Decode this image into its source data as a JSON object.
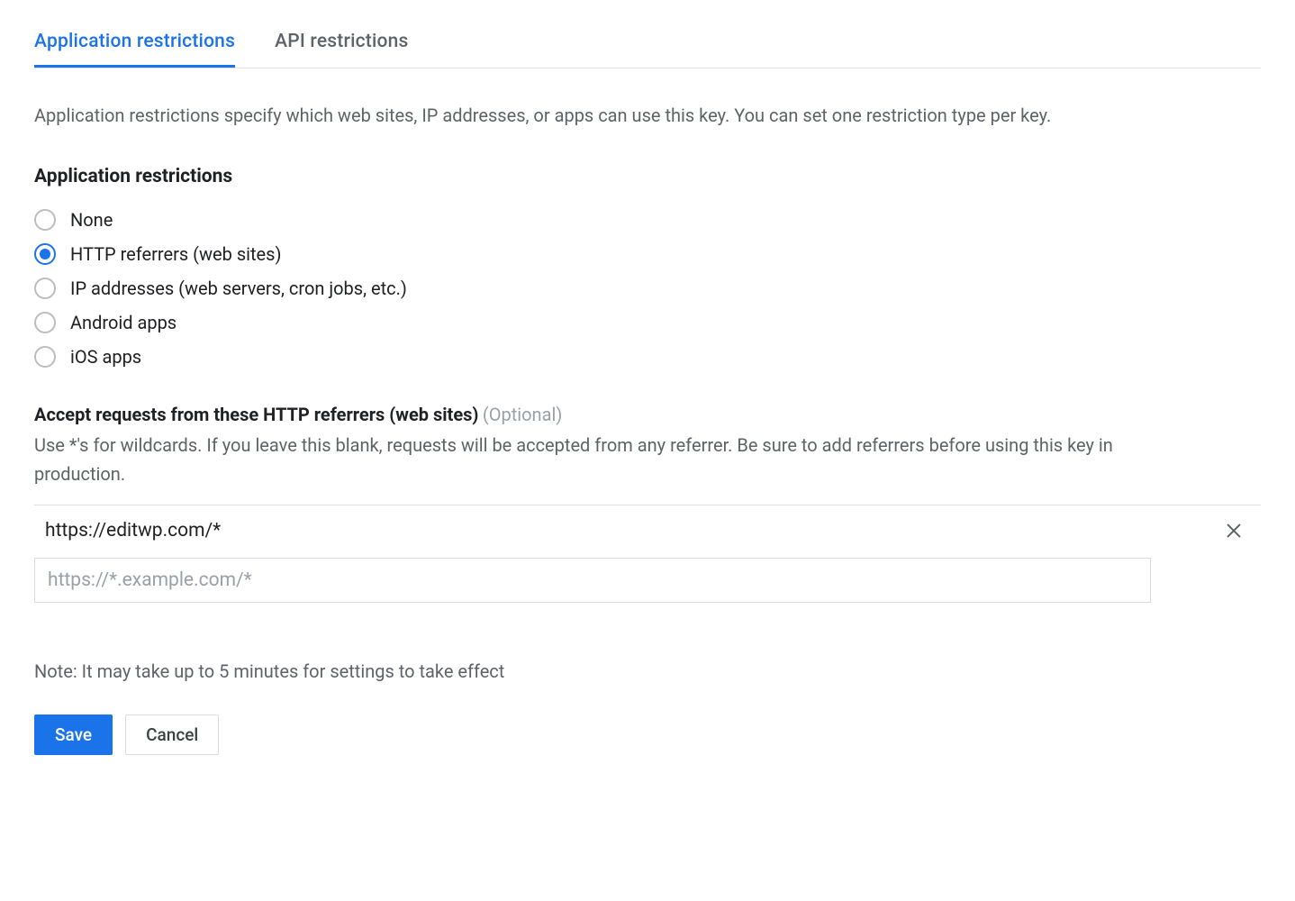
{
  "tabs": {
    "application_restrictions": "Application restrictions",
    "api_restrictions": "API restrictions",
    "active": "application_restrictions"
  },
  "description": "Application restrictions specify which web sites, IP addresses, or apps can use this key. You can set one restriction type per key.",
  "section": {
    "heading": "Application restrictions",
    "options": [
      {
        "id": "none",
        "label": "None",
        "selected": false
      },
      {
        "id": "http",
        "label": "HTTP referrers (web sites)",
        "selected": true
      },
      {
        "id": "ip",
        "label": "IP addresses (web servers, cron jobs, etc.)",
        "selected": false
      },
      {
        "id": "android",
        "label": "Android apps",
        "selected": false
      },
      {
        "id": "ios",
        "label": "iOS apps",
        "selected": false
      }
    ]
  },
  "referrers": {
    "heading": "Accept requests from these HTTP referrers (web sites)",
    "optional": "(Optional)",
    "description": "Use *'s for wildcards. If you leave this blank, requests will be accepted from any referrer. Be sure to add referrers before using this key in production.",
    "entries": [
      {
        "value": "https://editwp.com/*"
      }
    ],
    "input_placeholder": "https://*.example.com/*"
  },
  "note": "Note: It may take up to 5 minutes for settings to take effect",
  "buttons": {
    "save": "Save",
    "cancel": "Cancel"
  }
}
